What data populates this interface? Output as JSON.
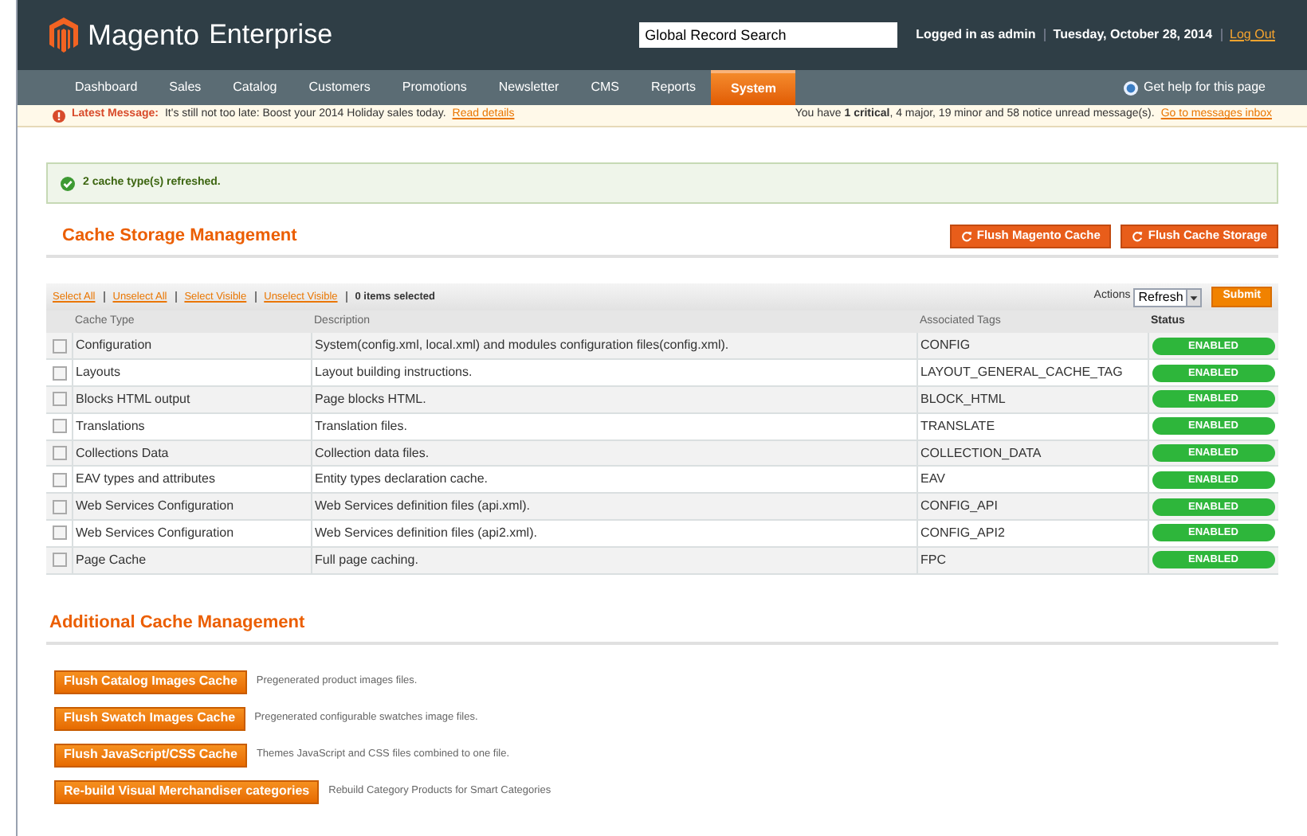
{
  "header": {
    "logo": "Magento",
    "logo_suffix": "Enterprise",
    "search": {
      "value": "Global Record Search"
    },
    "user": "Logged in as admin",
    "date": "Tuesday, October 28, 2014",
    "logout": "Log Out"
  },
  "nav": {
    "items": [
      {
        "label": "Dashboard",
        "selected": false
      },
      {
        "label": "Sales",
        "selected": false
      },
      {
        "label": "Catalog",
        "selected": false
      },
      {
        "label": "Customers",
        "selected": false
      },
      {
        "label": "Promotions",
        "selected": false
      },
      {
        "label": "Newsletter",
        "selected": false
      },
      {
        "label": "CMS",
        "selected": false
      },
      {
        "label": "Reports",
        "selected": false
      },
      {
        "label": "System",
        "selected": true
      }
    ],
    "help": "Get help for this page"
  },
  "notice": {
    "label": "Latest Message:",
    "text": "It's still not too late: Boost your 2014 Holiday sales today.",
    "link": "Read details",
    "summary": "You have **1 critical**, 4 major, 19 minor and 58 notice unread message(s).",
    "summary_link": "Go to messages inbox"
  },
  "success": "2 cache type(s) refreshed.",
  "cache_storage": {
    "title": "Cache Storage Management",
    "buttons": [
      "Flush Magento Cache",
      "Flush Cache Storage"
    ]
  },
  "grid": {
    "massaction": [
      "Select All",
      "Unselect All",
      "Select Visible",
      "Unselect Visible"
    ],
    "selected_count": "0 items selected",
    "actions_label": "Actions",
    "action": "Refresh",
    "submit": "Submit",
    "columns": [
      "Cache Type",
      "Description",
      "Associated Tags",
      "Status"
    ],
    "rows": [
      {
        "type": "Configuration",
        "description": "System(config.xml, local.xml) and modules configuration files(config.xml).",
        "tags": "CONFIG",
        "status": "ENABLED",
        "enabled": true,
        "checked": false
      },
      {
        "type": "Layouts",
        "description": "Layout building instructions.",
        "tags": "LAYOUT_GENERAL_CACHE_TAG",
        "status": "ENABLED",
        "enabled": true,
        "checked": false
      },
      {
        "type": "Blocks HTML output",
        "description": "Page blocks HTML.",
        "tags": "BLOCK_HTML",
        "status": "ENABLED",
        "enabled": true,
        "checked": false
      },
      {
        "type": "Translations",
        "description": "Translation files.",
        "tags": "TRANSLATE",
        "status": "ENABLED",
        "enabled": true,
        "checked": false
      },
      {
        "type": "Collections Data",
        "description": "Collection data files.",
        "tags": "COLLECTION_DATA",
        "status": "ENABLED",
        "enabled": true,
        "checked": false
      },
      {
        "type": "EAV types and attributes",
        "description": "Entity types declaration cache.",
        "tags": "EAV",
        "status": "ENABLED",
        "enabled": true,
        "checked": false
      },
      {
        "type": "Web Services Configuration",
        "description": "Web Services definition files (api.xml).",
        "tags": "CONFIG_API",
        "status": "ENABLED",
        "enabled": true,
        "checked": false
      },
      {
        "type": "Web Services Configuration",
        "description": "Web Services definition files (api2.xml).",
        "tags": "CONFIG_API2",
        "status": "ENABLED",
        "enabled": true,
        "checked": false
      },
      {
        "type": "Page Cache",
        "description": "Full page caching.",
        "tags": "FPC",
        "status": "ENABLED",
        "enabled": true,
        "checked": false
      }
    ]
  },
  "additional": {
    "title": "Additional Cache Management",
    "items": [
      {
        "button": "Flush Catalog Images Cache",
        "note": "Pregenerated product images files."
      },
      {
        "button": "Flush Swatch Images Cache",
        "note": "Pregenerated configurable swatches image files."
      },
      {
        "button": "Flush JavaScript/CSS Cache",
        "note": "Themes JavaScript and CSS files combined to one file."
      },
      {
        "button": "Re-build Visual Merchandiser categories",
        "note": "Rebuild Category Products for Smart Categories"
      }
    ]
  }
}
